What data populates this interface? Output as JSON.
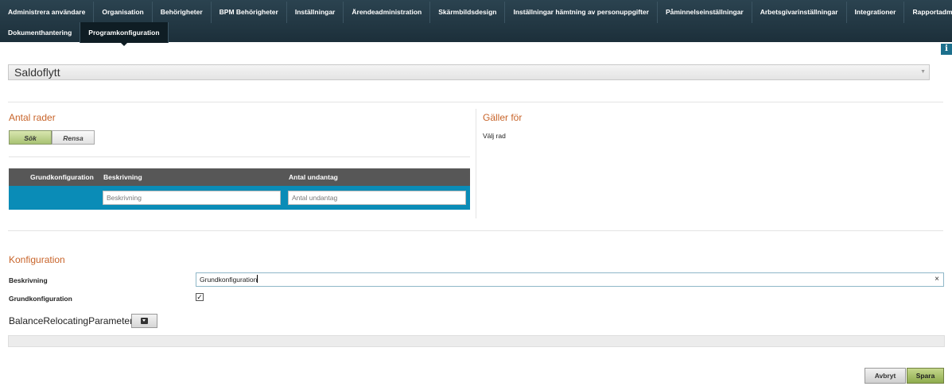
{
  "nav": {
    "row1": [
      "Administrera användare",
      "Organisation",
      "Behörigheter",
      "BPM Behörigheter",
      "Inställningar",
      "Ärendeadministration",
      "Skärmbildsdesign",
      "Inställningar hämtning av personuppgifter",
      "Påminnelseinställningar",
      "Arbetsgivarinställningar",
      "Integrationer",
      "Rapportadministration"
    ],
    "row2": [
      "Dokumenthantering",
      "Programkonfiguration"
    ],
    "active": "Programkonfiguration"
  },
  "info_icon": "i",
  "header_select": {
    "value": "Saldoflytt"
  },
  "search_section": {
    "title": "Antal rader",
    "search_button": "Sök",
    "clear_button": "Rensa"
  },
  "grid": {
    "columns": [
      "Grundkonfiguration",
      "Beskrivning",
      "Antal undantag"
    ],
    "filter_row": {
      "beskrivning_placeholder": "Beskrivning",
      "antal_placeholder": "Antal undantag"
    }
  },
  "applies_section": {
    "title": "Gäller för",
    "hint": "Välj rad"
  },
  "config_section": {
    "title": "Konfiguration",
    "beskrivning_label": "Beskrivning",
    "beskrivning_value": "Grundkonfiguration",
    "clear_icon": "×",
    "grundkonfiguration_label": "Grundkonfiguration",
    "grundkonfiguration_checked": true,
    "parameters_label": "BalanceRelocatingParameters"
  },
  "footer": {
    "cancel_button": "Avbryt",
    "save_button": "Spara"
  },
  "colors": {
    "nav_bg": "#23373f",
    "section_title": "#c8642a",
    "grid_header": "#575757",
    "grid_row": "#0a8cb7",
    "save_button": "#a3bd68"
  }
}
